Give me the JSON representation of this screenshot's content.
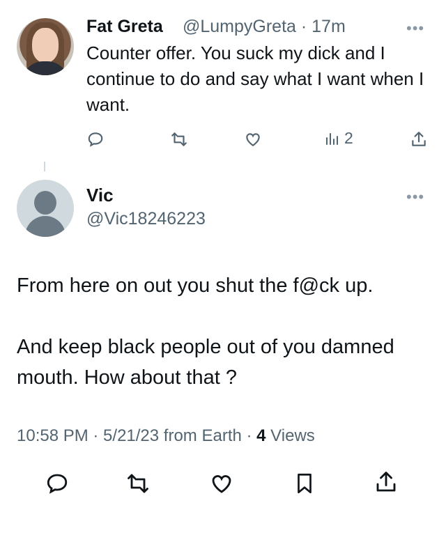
{
  "tweet1": {
    "name": "Fat Greta",
    "handle_time": "@LumpyGreta · 17m",
    "more": "•••",
    "text": "Counter offer. You suck my dick and I continue to do and say what I want when I want.",
    "views_count": "2",
    "icons": [
      "reply-icon",
      "retweet-icon",
      "like-icon",
      "views-icon",
      "share-icon"
    ]
  },
  "tweet2": {
    "name": "Vic",
    "handle": "@Vic18246223",
    "more": "•••",
    "text": "From here on out you shut the f@ck up.\n\nAnd keep black people out of you damned mouth. How about that  ?",
    "time_date": "10:58 PM · 5/21/23 from Earth · ",
    "views_number": "4",
    "views_label": " Views",
    "icons": [
      "reply-icon",
      "retweet-icon",
      "like-icon",
      "bookmark-icon",
      "share-icon"
    ]
  },
  "colors": {
    "text": "#0f1419",
    "secondary": "#536471",
    "line": "#cfd9de"
  }
}
